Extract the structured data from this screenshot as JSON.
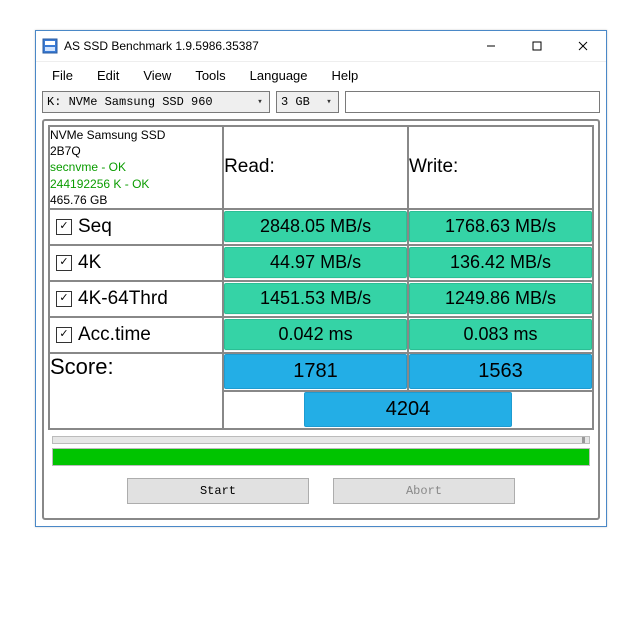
{
  "window": {
    "title": "AS SSD Benchmark 1.9.5986.35387"
  },
  "menu": {
    "file": "File",
    "edit": "Edit",
    "view": "View",
    "tools": "Tools",
    "language": "Language",
    "help": "Help"
  },
  "toolbar": {
    "drive": "K: NVMe Samsung SSD 960",
    "size": "3 GB"
  },
  "info": {
    "device": "NVMe Samsung SSD",
    "firmware": "2B7Q",
    "driver": "secnvme - OK",
    "alignment": "244192256 K - OK",
    "capacity": "465.76 GB"
  },
  "headers": {
    "read": "Read:",
    "write": "Write:"
  },
  "rows": {
    "seq": {
      "label": "Seq",
      "read": "2848.05 MB/s",
      "write": "1768.63 MB/s"
    },
    "k4": {
      "label": "4K",
      "read": "44.97 MB/s",
      "write": "136.42 MB/s"
    },
    "k464": {
      "label": "4K-64Thrd",
      "read": "1451.53 MB/s",
      "write": "1249.86 MB/s"
    },
    "acc": {
      "label": "Acc.time",
      "read": "0.042 ms",
      "write": "0.083 ms"
    }
  },
  "score": {
    "label": "Score:",
    "read": "1781",
    "write": "1563",
    "total": "4204"
  },
  "buttons": {
    "start": "Start",
    "abort": "Abort"
  }
}
